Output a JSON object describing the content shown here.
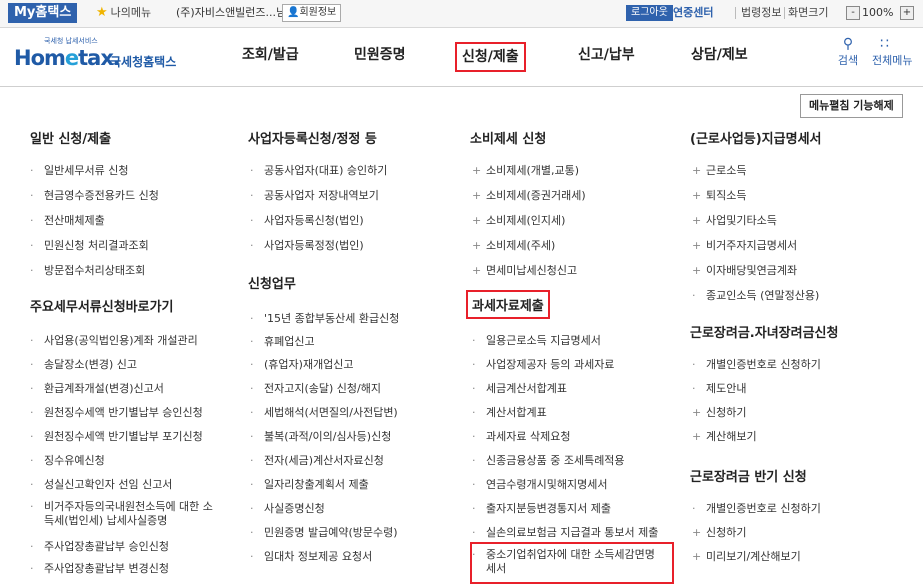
{
  "topbar": {
    "my_hometax": "My홈택스",
    "my_menu": "나의메뉴",
    "user_name": "(주)자비스앤빌런즈...님",
    "member_info": "회원정보",
    "logout": "로그아웃",
    "cert_center": "연중센터",
    "law_info": "법령정보",
    "screen_size": "화면크기",
    "zoom_minus": "-",
    "zoom_value": "100%",
    "zoom_plus": "+"
  },
  "header": {
    "logo_small": "국세청 납세서비스",
    "logo_home": "Hom",
    "logo_e": "e",
    "logo_tax": "tax.",
    "logo_kr": "국세청홈택스",
    "nav": [
      "조회/발급",
      "민원증명",
      "신청/제출",
      "신고/납부",
      "상담/제보"
    ],
    "search_label": "검색",
    "all_menu_label": "전체메뉴"
  },
  "menu_fold": "메뉴펼침 기능해제",
  "columns": {
    "col1": {
      "title1": "일반 신청/제출",
      "items1": [
        "일반세무서류 신청",
        "현금영수증전용카드 신청",
        "전산매체제출",
        "민원신청 처리결과조회",
        "방문접수처리상태조회"
      ],
      "title2": "주요세무서류신청바로가기",
      "items2": [
        "사업용(공익법인용)계좌 개설관리",
        "송달장소(변경) 신고",
        "환급계좌개설(변경)신고서",
        "원천징수세액 반기별납부 승인신청",
        "원천징수세액 반기별납부 포기신청",
        "징수유예신청",
        "성실신고확인자 선임 신고서",
        "비거주자등의국내원천소득에 대한 소",
        "득세(법인세) 납세사실증명",
        "주사업장총괄납부 승인신청",
        "주사업장총괄납부 변경신청"
      ]
    },
    "col2": {
      "title1": "사업자등록신청/정정 등",
      "items1": [
        "공동사업자(대표) 승인하기",
        "공동사업자 저장내역보기",
        "사업자등록신청(법인)",
        "사업자등록정정(법인)"
      ],
      "title2": "신청업무",
      "items2": [
        "'15년 종합부동산세 환급신청",
        "휴폐업신고",
        "(휴업자)재개업신고",
        "전자고지(송달) 신청/해지",
        "세법해석(서면질의/사전답변)",
        "불복(과적/이의/심사등)신청",
        "전자(세금)계산서자료신청",
        "일자리창출계획서 제출",
        "사실증명신청",
        "민원증명 발급예약(방문수령)",
        "임대차 정보제공 요청서"
      ]
    },
    "col3": {
      "title1": "소비제세 신청",
      "items1": [
        "소비제세(개별,교통)",
        "소비제세(증권거래세)",
        "소비제세(인지세)",
        "소비제세(주세)",
        "면세미납세신청신고"
      ],
      "title2": "과세자료제출",
      "items2": [
        "일용근로소득 지급명세서",
        "사업장제공자 등의 과세자료",
        "세금계산서합계표",
        "계산서합계표",
        "과세자료 삭제요청",
        "신종금융상품 중 조세특례적용",
        "연금수령개시및해지명세서",
        "출자지분등변경통지서 제출",
        "실손의료보험금 지급결과 통보서 제출",
        "중소기업취업자에 대한 소득세감면명",
        "세서"
      ]
    },
    "col4": {
      "title1": "(근로사업등)지급명세서",
      "items1": [
        "근로소득",
        "퇴직소득",
        "사업및기타소득",
        "비거주자지급명세서",
        "이자배당및연금계좌",
        "종교인소득 (연말정산용)"
      ],
      "title2": "근로장려금.자녀장려금신청",
      "items2": [
        "개별인증번호로 신청하기",
        "제도안내",
        "신청하기",
        "계산해보기"
      ],
      "title3": "근로장려금 반기 신청",
      "items3": [
        "개별인증번호로 신청하기",
        "신청하기",
        "미리보기/계산해보기"
      ]
    }
  },
  "colors": {
    "accent": "#2f62ad",
    "highlight": "#e8202a"
  }
}
